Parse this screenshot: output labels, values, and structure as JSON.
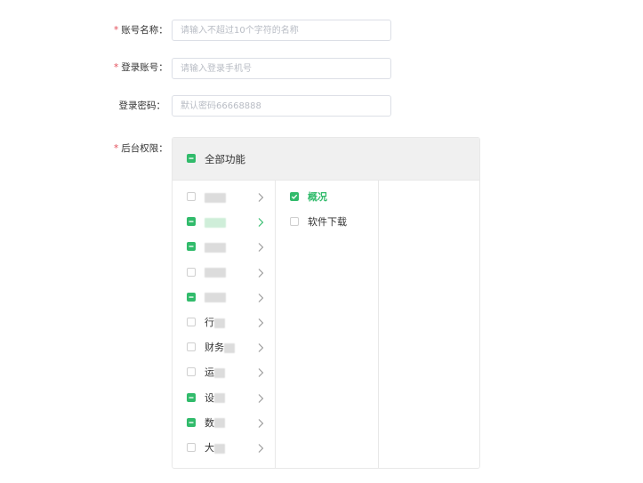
{
  "form": {
    "account_name": {
      "label": "账号名称：",
      "required_mark": "*",
      "value": "",
      "placeholder": "请输入不超过10个字符的名称"
    },
    "login_account": {
      "label": "登录账号：",
      "required_mark": "*",
      "value": "",
      "placeholder": "请输入登录手机号"
    },
    "login_password": {
      "label": "登录密码：",
      "value": "",
      "placeholder": "默认密码66668888"
    },
    "permissions": {
      "label": "后台权限：",
      "required_mark": "*",
      "select_all": {
        "label": "全部功能",
        "state": "indeterminate"
      },
      "level1": [
        {
          "label": "",
          "state": "unchecked",
          "redacted": true
        },
        {
          "label": "",
          "state": "indeterminate",
          "redacted": true,
          "active": true
        },
        {
          "label": "",
          "state": "indeterminate",
          "redacted": true
        },
        {
          "label": "",
          "state": "unchecked",
          "redacted": true
        },
        {
          "label": "",
          "state": "indeterminate",
          "redacted": true
        },
        {
          "label": "行",
          "state": "unchecked",
          "redacted": true
        },
        {
          "label": "财务",
          "state": "unchecked",
          "redacted": true
        },
        {
          "label": "运",
          "state": "unchecked",
          "redacted": true
        },
        {
          "label": "设",
          "state": "indeterminate",
          "redacted": true
        },
        {
          "label": "数",
          "state": "indeterminate",
          "redacted": true
        },
        {
          "label": "大",
          "state": "unchecked",
          "redacted": true
        }
      ],
      "level2": [
        {
          "label": "概况",
          "state": "checked"
        },
        {
          "label": "软件下载",
          "state": "unchecked"
        }
      ]
    }
  },
  "colors": {
    "accent": "#31bb6b",
    "required": "#e34d59",
    "border": "#dcdfe6",
    "header_bg": "#f0f0f0"
  }
}
